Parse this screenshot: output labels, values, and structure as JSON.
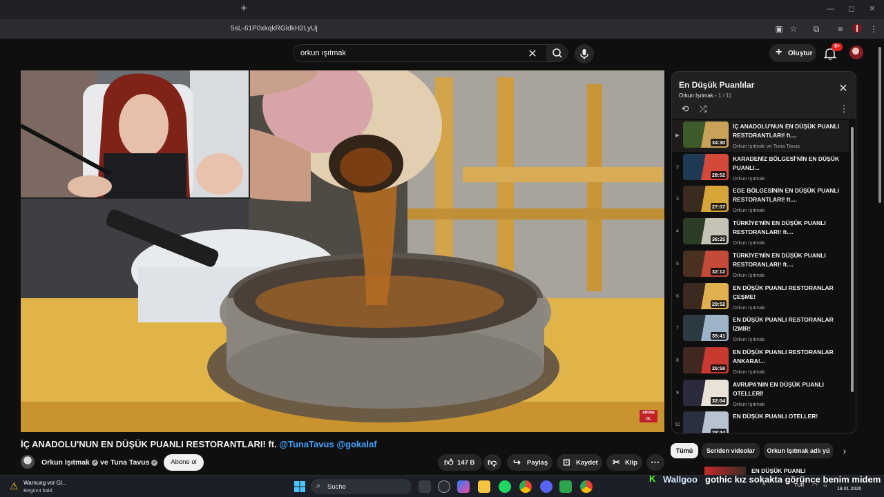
{
  "browser": {
    "url_fragment": "5sL-61P0xkqkRGldkH2LyUj",
    "new_tab_label": "+",
    "win_min": "—",
    "win_max": "◻",
    "win_close": "✕"
  },
  "header": {
    "search_value": "orkun ışıtmak",
    "create_label": "Oluştur",
    "notif_count": "9+"
  },
  "video": {
    "title_main": "İÇ ANADOLU'NUN EN DÜŞÜK PUANLI RESTORANTLARI! ft.",
    "mention_1": "@TunaTavus",
    "mention_2": "@gokalaf",
    "overlay_badge": "ABONE OL"
  },
  "channel": {
    "name_1": "Orkun Işıtmak",
    "joiner": "ve",
    "name_2": "Tuna Tavus",
    "subscribe_label": "Abone ol"
  },
  "actions": {
    "like_count": "147 B",
    "share_label": "Paylaş",
    "save_label": "Kaydet",
    "clip_label": "Klip",
    "more_label": "⋯"
  },
  "playlist": {
    "title": "En Düşük Puanlılar",
    "owner": "Orkun Işıtmak",
    "position": "1 / 11",
    "items": [
      {
        "index": "▶",
        "title": "İÇ ANADOLU'NUN EN DÜŞÜK PUANLI RESTORANTLARI! ft....",
        "channel": "Orkun Işıtmak ve Tuna Tavus",
        "duration": "34:30"
      },
      {
        "index": "2",
        "title": "KARADENİZ BÖLGESİ'NİN EN DÜŞÜK PUANLI...",
        "channel": "Orkun Işıtmak",
        "duration": "28:52"
      },
      {
        "index": "3",
        "title": "EGE BÖLGESİNİN EN DÜŞÜK PUANLI RESTORANTLARI! ft....",
        "channel": "Orkun Işıtmak",
        "duration": "27:07"
      },
      {
        "index": "4",
        "title": "TÜRKİYE'NİN EN DÜŞÜK PUANLI RESTORANLARI! ft....",
        "channel": "Orkun Işıtmak",
        "duration": "36:25"
      },
      {
        "index": "5",
        "title": "TÜRKİYE'NİN EN DÜŞÜK PUANLI RESTORANLARI! ft....",
        "channel": "Orkun Işıtmak",
        "duration": "32:12"
      },
      {
        "index": "6",
        "title": "EN DÜŞÜK PUANLI RESTORANLAR ÇEŞME!",
        "channel": "Orkun Işıtmak",
        "duration": "29:52"
      },
      {
        "index": "7",
        "title": "EN DÜŞÜK PUANLI RESTORANLAR İZMİR!",
        "channel": "Orkun Işıtmak",
        "duration": "35:41"
      },
      {
        "index": "8",
        "title": "EN DÜŞÜK PUANLI RESTORANLAR ANKARA!...",
        "channel": "Orkun Işıtmak",
        "duration": "26:58"
      },
      {
        "index": "9",
        "title": "AVRUPA'NIN EN DÜŞÜK PUANLI OTELLERİ!",
        "channel": "Orkun Işıtmak",
        "duration": "32:04"
      },
      {
        "index": "10",
        "title": "EN DÜŞÜK PUANLI OTELLER!",
        "channel": "Orkun Işıtmak",
        "duration": "28:44"
      }
    ]
  },
  "chips": {
    "all": "Tümü",
    "series": "Seriden videolar",
    "uploaded_by": "Orkun Işıtmak adlı yü"
  },
  "next_video": {
    "title": "EN DÜŞÜK PUANLI"
  },
  "taskbar": {
    "warning_title": "Warnung vor Gl...",
    "warning_sub": "Beginnt bald",
    "search_label": "Suche",
    "lang": "TUR",
    "date": "18.01.2026"
  },
  "ticker": {
    "user": "Wallgoo",
    "message": "gothic kız sokakta görünce benim midem"
  },
  "colors": {
    "background": "#0f0f0f",
    "panel": "#212121",
    "accent_link": "#3ea6ff",
    "kick_green": "#53fc18",
    "notif_red": "#e52020"
  }
}
